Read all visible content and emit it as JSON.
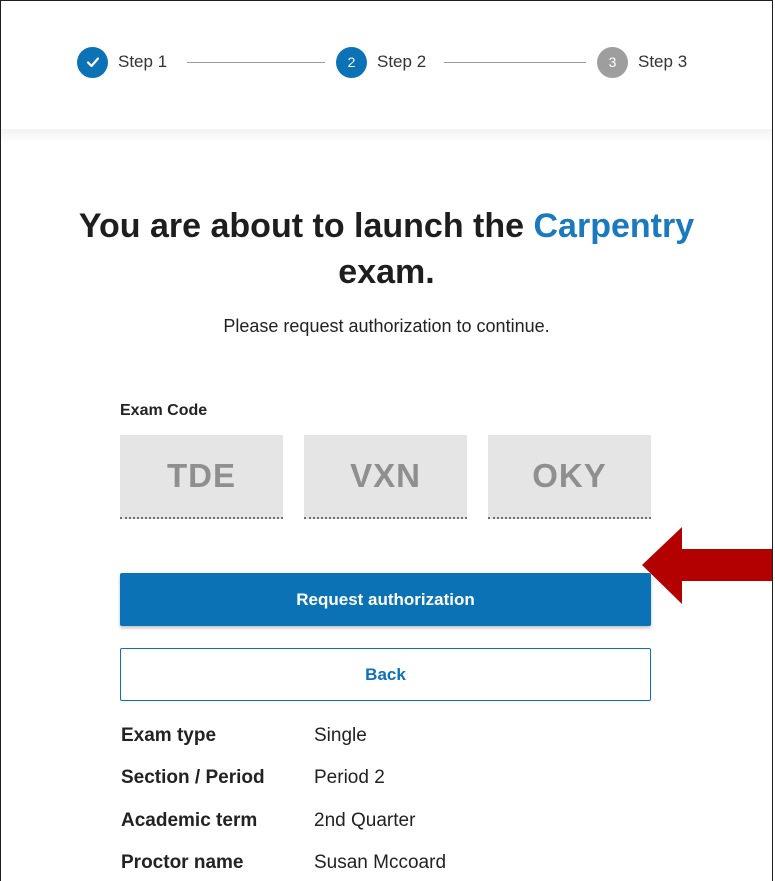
{
  "stepper": {
    "steps": [
      {
        "label": "Step 1",
        "marker": "",
        "state": "complete",
        "icon": "check-icon"
      },
      {
        "label": "Step 2",
        "marker": "2",
        "state": "active"
      },
      {
        "label": "Step 3",
        "marker": "3",
        "state": "pending"
      }
    ]
  },
  "heading": {
    "prefix": "You are about to launch the",
    "exam_name": "Carpentry",
    "suffix": "exam."
  },
  "subtitle": "Please request authorization to continue.",
  "exam_code": {
    "label": "Exam Code",
    "parts": [
      "TDE",
      "VXN",
      "OKY"
    ]
  },
  "buttons": {
    "request_label": "Request authorization",
    "back_label": "Back"
  },
  "details": [
    {
      "key": "Exam type",
      "value": "Single"
    },
    {
      "key": "Section / Period",
      "value": "Period 2"
    },
    {
      "key": "Academic term",
      "value": "2nd Quarter"
    },
    {
      "key": "Proctor name",
      "value": "Susan Mccoard"
    }
  ],
  "colors": {
    "primary": "#0b72b5",
    "accent_text": "#1a7abf",
    "step_active": "#0b72b5",
    "step_pending": "#9e9e9e",
    "annotation_arrow": "#b30000"
  }
}
